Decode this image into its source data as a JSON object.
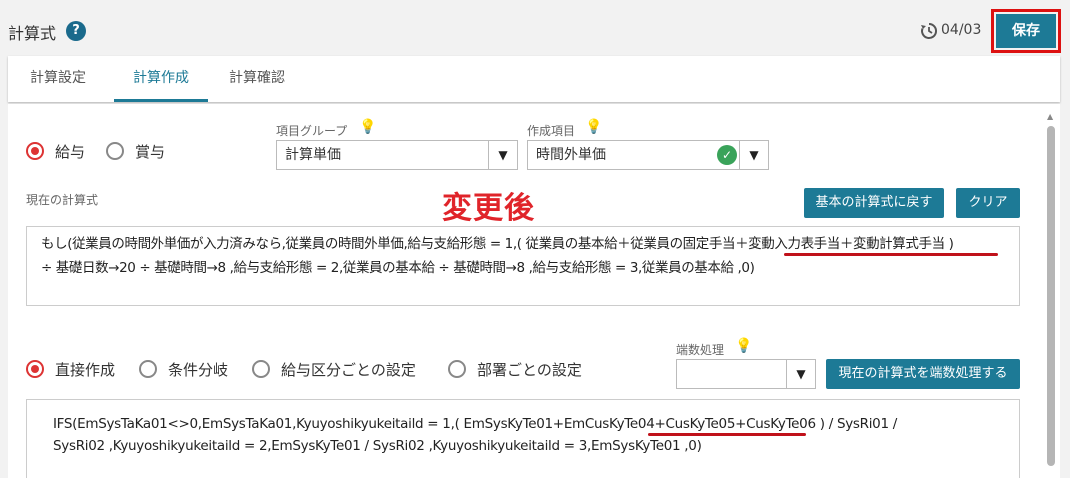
{
  "header": {
    "title": "計算式",
    "help_icon": "?",
    "history_date": "04/03",
    "save_label": "保存"
  },
  "tabs": [
    {
      "label": "計算設定",
      "active": false
    },
    {
      "label": "計算作成",
      "active": true
    },
    {
      "label": "計算確認",
      "active": false
    }
  ],
  "type_radios": [
    {
      "label": "給与",
      "checked": true
    },
    {
      "label": "賞与",
      "checked": false
    }
  ],
  "item_group": {
    "label": "項目グループ",
    "value": "計算単価"
  },
  "create_item": {
    "label": "作成項目",
    "value": "時間外単価"
  },
  "current_formula": {
    "label": "現在の計算式",
    "reset_button": "基本の計算式に戻す",
    "clear_button": "クリア",
    "annotation": "変更後",
    "line1": "もし(従業員の時間外単価が入力済みなら,従業員の時間外単価,給与支給形態 = 1,( 従業員の基本給＋従業員の固定手当＋変動入力表手当＋変動計算式手当 )",
    "line2": "÷ 基礎日数→20 ÷ 基礎時間→8 ,給与支給形態 = 2,従業員の基本給 ÷ 基礎時間→8 ,給与支給形態 = 3,従業員の基本給 ,0)"
  },
  "mode_radios": [
    {
      "label": "直接作成",
      "checked": true
    },
    {
      "label": "条件分岐",
      "checked": false
    },
    {
      "label": "給与区分ごとの設定",
      "checked": false
    },
    {
      "label": "部署ごとの設定",
      "checked": false
    }
  ],
  "rounding": {
    "label": "端数処理",
    "value": "",
    "apply_button": "現在の計算式を端数処理する"
  },
  "direct_formula": {
    "line1": "IFS(EmSysTaKa01<>0,EmSysTaKa01,Kyuyoshikyukeitaild = 1,( EmSysKyTe01+EmCusKyTe04+CusKyTe05+CusKyTe06 ) / SysRi01 /",
    "line2": "SysRi02 ,Kyuyoshikyukeitaild = 2,EmSysKyTe01 / SysRi02 ,Kyuyoshikyukeitaild = 3,EmSysKyTe01 ,0)"
  },
  "colors": {
    "accent": "#1d7a96",
    "highlight": "#e0242a",
    "radio_on": "#d33333",
    "check": "#3aa35a"
  },
  "icons": {
    "help": "help-icon",
    "history": "history-icon",
    "bulb": "lightbulb-icon",
    "check": "check-circle-icon",
    "caret": "chevron-down-icon"
  }
}
